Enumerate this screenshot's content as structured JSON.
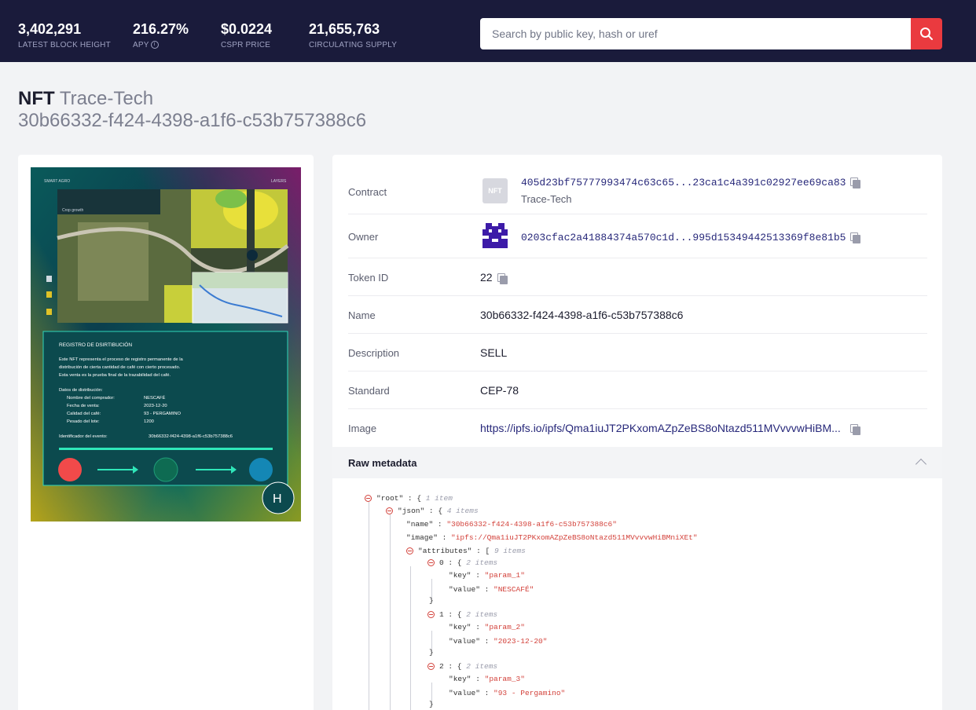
{
  "stats": [
    {
      "value": "3,402,291",
      "label": "LATEST BLOCK HEIGHT"
    },
    {
      "value": "216.27%",
      "label": "APY"
    },
    {
      "value": "$0.0224",
      "label": "CSPR PRICE"
    },
    {
      "value": "21,655,763",
      "label": "CIRCULATING SUPPLY"
    }
  ],
  "search": {
    "placeholder": "Search by public key, hash or uref"
  },
  "page": {
    "title_prefix": "NFT",
    "title_name": "Trace-Tech",
    "title_id": "30b66332-f424-4398-a1f6-c53b757388c6"
  },
  "nft_image": {
    "header_left": "SMART AGRO",
    "header_right": "LAYERS",
    "map_label": "Crop growth",
    "panel_title": "REGISTRO DE DSIRTIBUCIÓN",
    "panel_text_1": "Este NFT representa el proceso de registro permanente de la",
    "panel_text_2": "distribución de cierta cantidad de café con cierto procesado.",
    "panel_text_3": "Esta venta es la prueba final de la trazabilidad del café.",
    "data_title": "Datos de distribución:",
    "fields": [
      {
        "k": "Nombre del comprador:",
        "v": "NESCAFÉ"
      },
      {
        "k": "Fecha de venta:",
        "v": "2023-12-20"
      },
      {
        "k": "Calidad del café:",
        "v": "93 - PERGAMINO"
      },
      {
        "k": "Pesado del lote:",
        "v": "1200"
      }
    ],
    "event_label": "Identificador del evento:",
    "event_id": "30b66332-f424-4398-a1f6-c53b757388c6",
    "logo_letter": "H"
  },
  "details": {
    "contract_label": "Contract",
    "contract_badge": "NFT",
    "contract_hash": "405d23bf75777993474c63c65...23ca1c4a391c02927ee69ca83",
    "contract_name": "Trace-Tech",
    "owner_label": "Owner",
    "owner_hash": "0203cfac2a41884374a570c1d...995d15349442513369f8e81b5",
    "token_id_label": "Token ID",
    "token_id": "22",
    "name_label": "Name",
    "name": "30b66332-f424-4398-a1f6-c53b757388c6",
    "description_label": "Description",
    "description": "SELL",
    "standard_label": "Standard",
    "standard": "CEP-78",
    "image_label": "Image",
    "image_url": "https://ipfs.io/ipfs/Qma1iuJT2PKxomAZpZeBS8oNtazd511MVvvvwHiBM..."
  },
  "raw": {
    "title": "Raw metadata",
    "root_key": "\"root\"",
    "root_count": "1 item",
    "json_key": "\"json\"",
    "json_count": "4 items",
    "name_key": "\"name\"",
    "name_val": "\"30b66332-f424-4398-a1f6-c53b757388c6\"",
    "image_key": "\"image\"",
    "image_val": "\"ipfs://Qma1iuJT2PKxomAZpZeBS8oNtazd511MVvvvwHiBMniXEt\"",
    "attr_key": "\"attributes\"",
    "attr_count": "9 items",
    "items": [
      {
        "idx": "0",
        "count": "2 items",
        "key": "\"param_1\"",
        "value": "\"NESCAFÉ\""
      },
      {
        "idx": "1",
        "count": "2 items",
        "key": "\"param_2\"",
        "value": "\"2023-12-20\""
      },
      {
        "idx": "2",
        "count": "2 items",
        "key": "\"param_3\"",
        "value": "\"93 - Pergamino\""
      }
    ],
    "key_word": "\"key\"",
    "value_word": "\"value\""
  }
}
